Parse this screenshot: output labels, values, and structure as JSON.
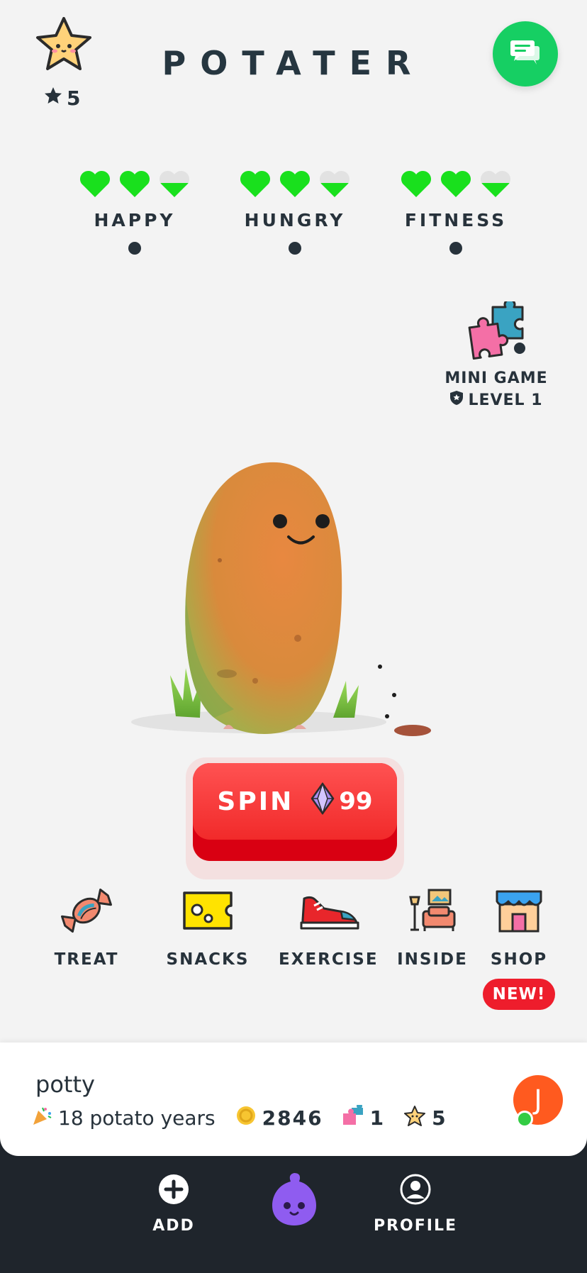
{
  "header": {
    "title": "POTATER",
    "star_count": "5"
  },
  "stats": [
    {
      "label": "HAPPY",
      "level": 0.8333
    },
    {
      "label": "HUNGRY",
      "level": 0.8333
    },
    {
      "label": "FITNESS",
      "level": 0.8333
    }
  ],
  "mini_game": {
    "title": "MINI GAME",
    "level": "LEVEL 1"
  },
  "spin": {
    "label": "SPIN",
    "cost": "99"
  },
  "actions": [
    {
      "label": "TREAT",
      "icon": "candy-icon"
    },
    {
      "label": "SNACKS",
      "icon": "cheese-icon"
    },
    {
      "label": "EXERCISE",
      "icon": "sneaker-icon"
    },
    {
      "label": "INSIDE",
      "icon": "living-room-icon"
    },
    {
      "label": "SHOP",
      "icon": "shop-icon"
    }
  ],
  "shop_badge": "NEW!",
  "pet": {
    "name": "potty",
    "age": "18 potato years",
    "coins": "2846",
    "puzzles": "1",
    "stars": "5"
  },
  "user": {
    "initial": "J"
  },
  "nav": {
    "add_label": "ADD",
    "profile_label": "PROFILE"
  },
  "colors": {
    "accent_green": "#16cf63",
    "heart_green": "#19e01d",
    "spin_red": "#f12a2a",
    "badge_red": "#ee1d2c",
    "nav_dark": "#1f252c"
  }
}
